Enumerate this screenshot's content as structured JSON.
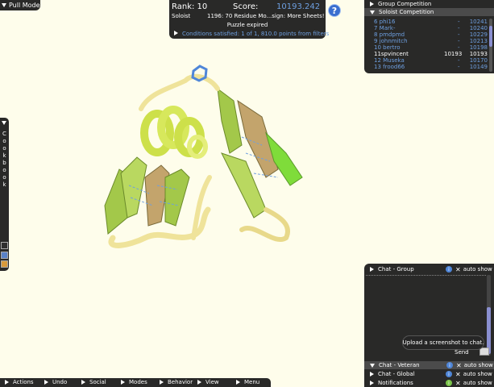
{
  "pull_mode": {
    "label": "Pull Mode"
  },
  "score_panel": {
    "rank": "Rank: 10",
    "score_label": "Score:",
    "score_value": "10193.242",
    "soloist": "Soloist",
    "puzzle_name": "1196: 70 Residue Mo...sign: More Sheets!",
    "status": "Puzzle expired",
    "conditions": "Conditions satisfied: 1 of 1, 810.0 points from filters"
  },
  "help": {
    "label": "?"
  },
  "competition": {
    "group_label": "Group Competition",
    "soloist_label": "Soloist Competition",
    "rows": [
      {
        "name": "6 phi16",
        "mid": "",
        "dash": "-",
        "points": "10241",
        "self": false
      },
      {
        "name": "7 Mark-",
        "mid": "",
        "dash": "-",
        "points": "10240",
        "self": false
      },
      {
        "name": "8 pmdpmd",
        "mid": "",
        "dash": "-",
        "points": "10229",
        "self": false
      },
      {
        "name": "9 johnmitch",
        "mid": "",
        "dash": "-",
        "points": "10213",
        "self": false
      },
      {
        "name": "10 bertro",
        "mid": "",
        "dash": "-",
        "points": "10198",
        "self": false
      },
      {
        "name": "11spvincent",
        "mid": "10193",
        "dash": "",
        "points": "10193",
        "self": true
      },
      {
        "name": "12 Museka",
        "mid": "",
        "dash": "-",
        "points": "10170",
        "self": false
      },
      {
        "name": "13 frood66",
        "mid": "",
        "dash": "-",
        "points": "10149",
        "self": false
      }
    ]
  },
  "cookbook": {
    "letters": [
      "C",
      "o",
      "o",
      "k",
      "b",
      "o",
      "o",
      "k"
    ]
  },
  "chat": {
    "group": {
      "label": "Chat - Group",
      "info": "i",
      "close": "✕",
      "auto": "auto show"
    },
    "send_label": "Send",
    "tooltip": "Upload a screenshot to chat.",
    "veteran": {
      "label": "Chat - Veteran",
      "info": "i",
      "close": "✕",
      "auto": "auto show"
    },
    "global": {
      "label": "Chat - Global",
      "info": "i",
      "close": "✕",
      "auto": "auto show"
    },
    "notifications": {
      "label": "Notifications",
      "info": "i",
      "close": "✕",
      "auto": "auto show"
    }
  },
  "menu": {
    "actions": "Actions",
    "undo": "Undo",
    "social": "Social",
    "modes": "Modes",
    "behavior": "Behavior",
    "view": "View",
    "menu": "Menu"
  },
  "colors": {
    "background": "#fefdeb",
    "panel": "#1c1c1c",
    "accent_blue": "#6e9fe0",
    "helix": "#cde04a",
    "sheet": "#a3c84a",
    "loop": "#efe39a"
  }
}
